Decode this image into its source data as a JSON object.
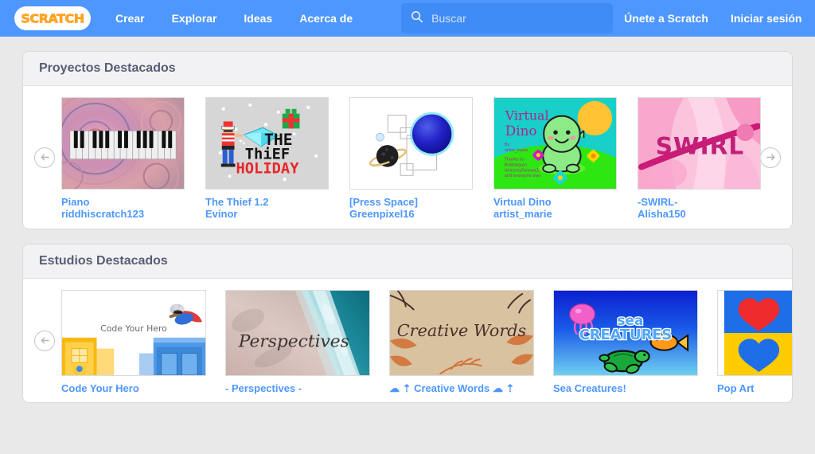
{
  "header": {
    "logo_text": "SCRATCH",
    "nav_items": [
      {
        "label": "Crear",
        "name": "nav-crear"
      },
      {
        "label": "Explorar",
        "name": "nav-explorar"
      },
      {
        "label": "Ideas",
        "name": "nav-ideas"
      },
      {
        "label": "Acerca de",
        "name": "nav-acerca-de"
      }
    ],
    "search": {
      "placeholder": "Buscar",
      "value": "",
      "icon": "search-icon"
    },
    "join_label": "Únete a Scratch",
    "signin_label": "Iniciar sesión",
    "bg_color": "#4d97ff"
  },
  "sections": {
    "projects": {
      "title": "Proyectos Destacados",
      "prev_icon": "arrow-left-icon",
      "next_icon": "arrow-right-icon",
      "cards": [
        {
          "title": "Piano",
          "author": "riddhiscratch123",
          "thumb": "piano-swirl"
        },
        {
          "title": "The Thief 1.2",
          "author": "Evinor",
          "thumb": "thief-holiday"
        },
        {
          "title": "[Press Space]",
          "author": "Greenpixel16",
          "thumb": "press-space-planets"
        },
        {
          "title": "Virtual Dino",
          "author": "artist_marie",
          "thumb": "virtual-dino"
        },
        {
          "title": "-SWIRL-",
          "author": "Alisha150",
          "thumb": "swirl-pink"
        }
      ]
    },
    "studios": {
      "title": "Estudios Destacados",
      "prev_icon": "arrow-left-icon",
      "next_icon": "arrow-right-icon",
      "cards": [
        {
          "title": "Code Your Hero",
          "thumb": "code-your-hero",
          "thumb_text": "Code Your Hero"
        },
        {
          "title": "- Perspectives -",
          "thumb": "perspectives-beach",
          "thumb_text": "Perspectives"
        },
        {
          "title": "☁ ⇡ Creative Words ☁ ⇡",
          "thumb": "creative-words",
          "thumb_text": "Creative Words"
        },
        {
          "title": "Sea Creatures!",
          "thumb": "sea-creatures",
          "thumb_text": "sea CREATURES"
        },
        {
          "title": "Pop Art",
          "thumb": "pop-art-hearts",
          "thumb_text": ""
        }
      ]
    }
  },
  "colors": {
    "brand_blue": "#4d97ff",
    "link_blue": "#4d97ff",
    "logo_orange": "#ffab19",
    "heading_gray": "#575e75",
    "page_bg": "#e9e9e9"
  }
}
